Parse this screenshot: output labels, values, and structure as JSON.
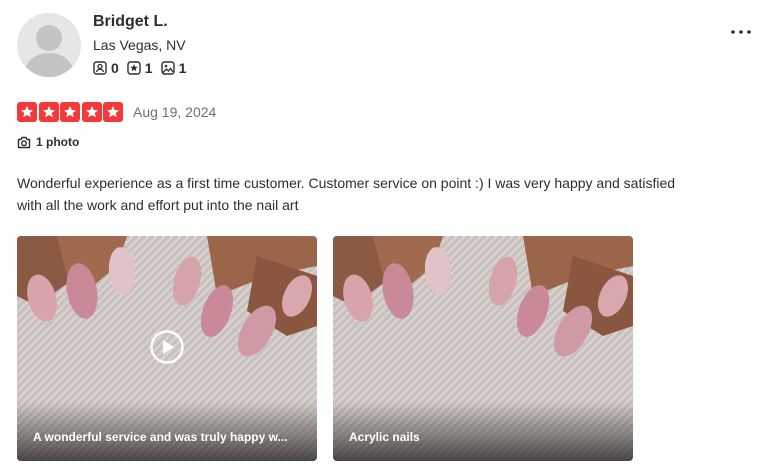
{
  "user": {
    "name": "Bridget L.",
    "location": "Las Vegas, NV",
    "stats": [
      {
        "icon": "friends-icon",
        "value": "0"
      },
      {
        "icon": "reviews-icon",
        "value": "1"
      },
      {
        "icon": "photos-icon",
        "value": "1"
      }
    ]
  },
  "review": {
    "rating": 5,
    "date": "Aug 19, 2024",
    "photo_count_label": "1 photo",
    "text": "Wonderful experience as a first time customer. Customer service on point :) I was very happy and satisfied with all the work and effort put into the nail art"
  },
  "media": [
    {
      "caption": "A wonderful service and was truly happy w...",
      "type": "video"
    },
    {
      "caption": "Acrylic nails",
      "type": "photo"
    }
  ],
  "colors": {
    "star_red": "#f43939",
    "text": "#2d2e2f",
    "muted": "#6e7072"
  }
}
